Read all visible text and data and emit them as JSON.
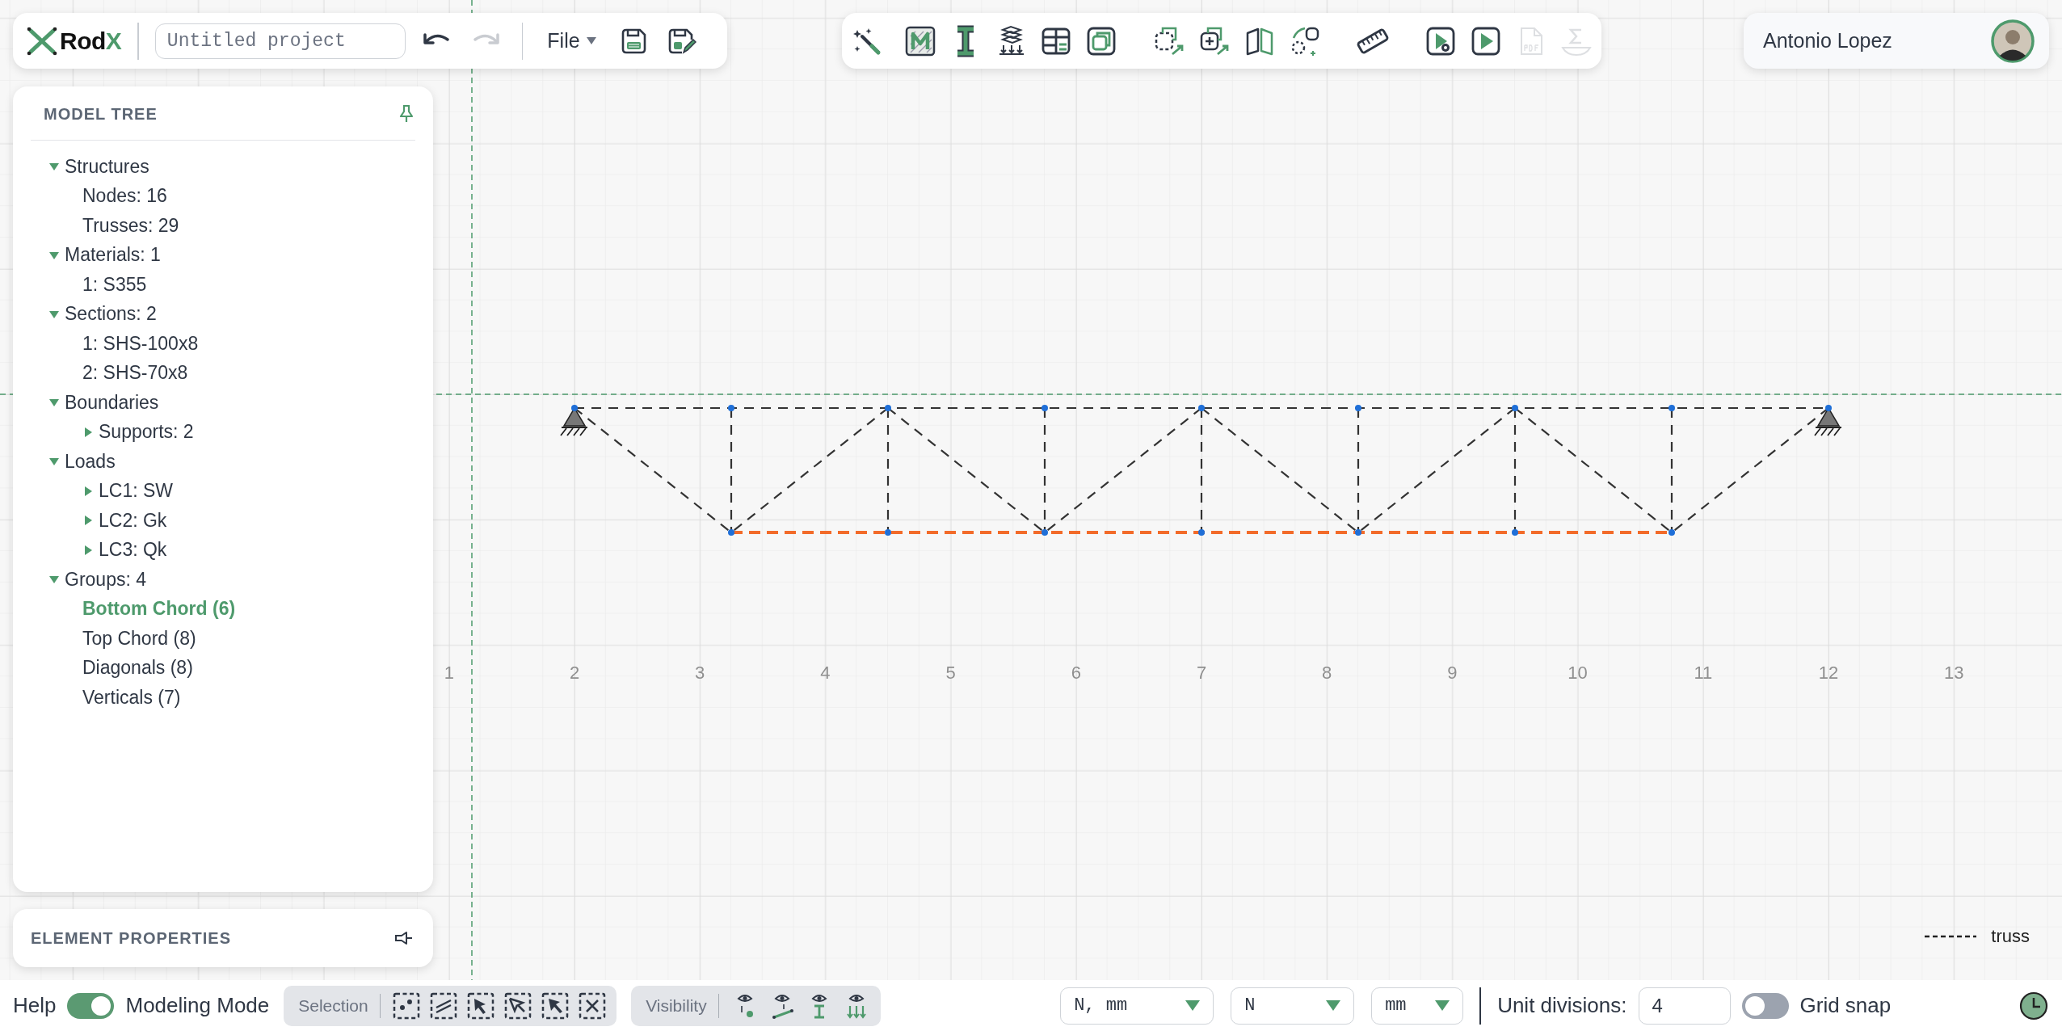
{
  "toolbar": {
    "logo": {
      "text": "Rod",
      "accent": "X"
    },
    "project_name": {
      "placeholder": "Untitled project"
    },
    "undo": {
      "disabled": false
    },
    "redo": {
      "disabled": true
    },
    "file_menu": "File"
  },
  "tool_groups": [
    {
      "tools": [
        {
          "kind": "wand",
          "disabled": false
        },
        {
          "kind": "material",
          "disabled": false
        },
        {
          "kind": "section",
          "disabled": false
        },
        {
          "kind": "loads",
          "disabled": false
        },
        {
          "kind": "table",
          "disabled": false
        },
        {
          "kind": "copy",
          "disabled": false
        }
      ]
    },
    {
      "tools": [
        {
          "kind": "select-move",
          "disabled": false
        },
        {
          "kind": "add-move",
          "disabled": false
        },
        {
          "kind": "panel",
          "disabled": false
        },
        {
          "kind": "path",
          "disabled": false
        }
      ]
    },
    {
      "tools": [
        {
          "kind": "ruler",
          "disabled": false
        }
      ]
    },
    {
      "tools": [
        {
          "kind": "run-settings",
          "disabled": false
        },
        {
          "kind": "run",
          "disabled": false
        },
        {
          "kind": "pdf",
          "disabled": true
        },
        {
          "kind": "sigma",
          "disabled": true
        }
      ]
    }
  ],
  "user": {
    "name": "Antonio Lopez"
  },
  "model_tree": {
    "title": "MODEL TREE",
    "items": [
      {
        "kind": "folder",
        "label": "Structures",
        "expanded": true,
        "selected": false,
        "children": [
          {
            "kind": "leaf",
            "label": "Nodes: 16",
            "selected": false
          },
          {
            "kind": "leaf",
            "label": "Trusses: 29",
            "selected": false
          }
        ]
      },
      {
        "kind": "folder",
        "label": "Materials: 1",
        "expanded": true,
        "selected": false,
        "children": [
          {
            "kind": "leaf",
            "label": "1: S355",
            "selected": false
          }
        ]
      },
      {
        "kind": "folder",
        "label": "Sections: 2",
        "expanded": true,
        "selected": false,
        "children": [
          {
            "kind": "leaf",
            "label": "1: SHS-100x8",
            "selected": false
          },
          {
            "kind": "leaf",
            "label": "2: SHS-70x8",
            "selected": false
          }
        ]
      },
      {
        "kind": "folder",
        "label": "Boundaries",
        "expanded": true,
        "selected": false,
        "children": [
          {
            "kind": "folder",
            "label": "Supports: 2",
            "expanded": false,
            "selected": false
          }
        ]
      },
      {
        "kind": "folder",
        "label": "Loads",
        "expanded": true,
        "selected": false,
        "children": [
          {
            "kind": "folder",
            "label": "LC1: SW",
            "expanded": false,
            "selected": false
          },
          {
            "kind": "folder",
            "label": "LC2: Gk",
            "expanded": false,
            "selected": false
          },
          {
            "kind": "folder",
            "label": "LC3: Qk",
            "expanded": false,
            "selected": false
          }
        ]
      },
      {
        "kind": "folder",
        "label": "Groups: 4",
        "expanded": true,
        "selected": false,
        "children": [
          {
            "kind": "leaf",
            "label": "Bottom Chord (6)",
            "selected": true
          },
          {
            "kind": "leaf",
            "label": "Top Chord (8)",
            "selected": false
          },
          {
            "kind": "leaf",
            "label": "Diagonals (8)",
            "selected": false
          },
          {
            "kind": "leaf",
            "label": "Verticals (7)",
            "selected": false
          }
        ]
      }
    ]
  },
  "element_properties": {
    "title": "ELEMENT PROPERTIES"
  },
  "canvas": {
    "axis_labels": [
      "1",
      "2",
      "3",
      "4",
      "5",
      "6",
      "7",
      "8",
      "9",
      "10",
      "11",
      "12",
      "13"
    ],
    "legend": "truss"
  },
  "status_bar": {
    "help": "Help",
    "modeling_mode": {
      "label": "Modeling Mode",
      "on": true
    },
    "selection": {
      "label": "Selection",
      "tools": [
        {
          "kind": "nodes"
        },
        {
          "kind": "members"
        },
        {
          "kind": "pick"
        },
        {
          "kind": "pick-many"
        },
        {
          "kind": "pointer"
        },
        {
          "kind": "clear"
        }
      ]
    },
    "visibility": {
      "label": "Visibility",
      "tools": [
        {
          "kind": "node-labels"
        },
        {
          "kind": "member-labels"
        },
        {
          "kind": "sections"
        },
        {
          "kind": "loads"
        }
      ]
    },
    "units": [
      {
        "value": "N, mm"
      },
      {
        "value": "N"
      },
      {
        "value": "mm"
      }
    ],
    "unit_divisions": {
      "label": "Unit divisions:",
      "value": "4"
    },
    "grid_snap": {
      "label": "Grid snap",
      "on": false
    }
  }
}
